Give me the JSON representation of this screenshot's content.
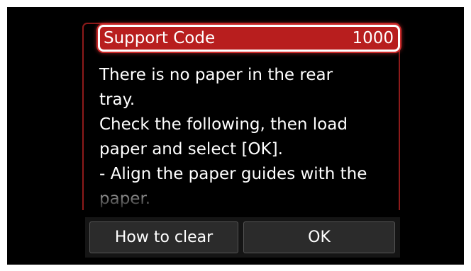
{
  "dialog": {
    "header_title": "Support Code",
    "support_code": "1000",
    "message": "There is no paper in the rear\ntray.\nCheck the following, then load\npaper and select [OK].\n- Align the paper guides with the\npaper."
  },
  "buttons": {
    "how_to_clear": "How to clear",
    "ok": "OK"
  },
  "colors": {
    "screen_background": "#000000",
    "header_fill": "#b81e1e",
    "dialog_border": "#8e1a1a",
    "button_fill": "#2b2b2b",
    "text": "#ffffff"
  }
}
